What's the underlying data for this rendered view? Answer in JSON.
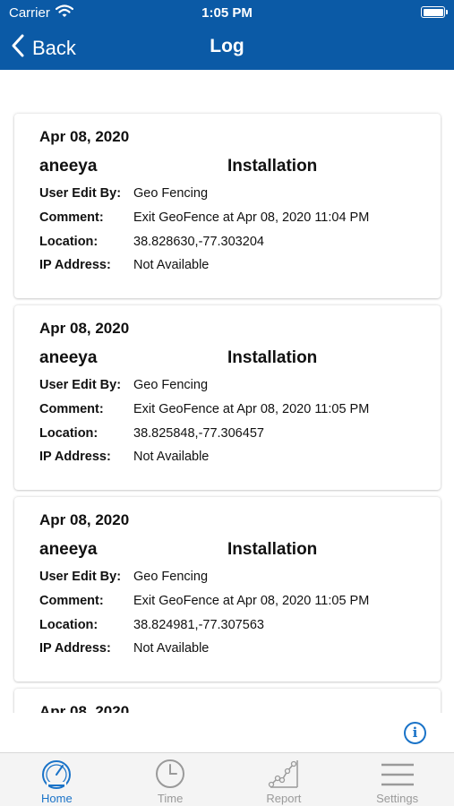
{
  "status_bar": {
    "carrier": "Carrier",
    "time": "1:05 PM"
  },
  "nav": {
    "back_label": "Back",
    "title": "Log"
  },
  "field_labels": {
    "user_edit_by": "User Edit By:",
    "comment": "Comment:",
    "location": "Location:",
    "ip_address": "IP Address:"
  },
  "logs": [
    {
      "date": "Apr 08, 2020",
      "user": "aneeya",
      "category": "Installation",
      "user_edit_by": "Geo Fencing",
      "comment": "Exit GeoFence at Apr 08, 2020 11:04 PM",
      "location": "38.828630,-77.303204",
      "ip_address": "Not Available"
    },
    {
      "date": "Apr 08, 2020",
      "user": "aneeya",
      "category": "Installation",
      "user_edit_by": "Geo Fencing",
      "comment": "Exit GeoFence at Apr 08, 2020 11:05 PM",
      "location": "38.825848,-77.306457",
      "ip_address": "Not Available"
    },
    {
      "date": "Apr 08, 2020",
      "user": "aneeya",
      "category": "Installation",
      "user_edit_by": "Geo Fencing",
      "comment": "Exit GeoFence at Apr 08, 2020 11:05 PM",
      "location": "38.824981,-77.307563",
      "ip_address": "Not Available"
    },
    {
      "date": "Apr 08, 2020"
    }
  ],
  "info_button": {
    "icon": "info-icon",
    "glyph": "i"
  },
  "tab_bar": {
    "active_color": "#1a73c8",
    "tabs": [
      {
        "label": "Home",
        "icon": "speedometer-icon",
        "active": true
      },
      {
        "label": "Time",
        "icon": "clock-icon",
        "active": false
      },
      {
        "label": "Report",
        "icon": "line-chart-icon",
        "active": false
      },
      {
        "label": "Settings",
        "icon": "hamburger-menu-icon",
        "active": false
      }
    ]
  },
  "colors": {
    "header": "#0b5aa6",
    "accent": "#1a73c8"
  }
}
